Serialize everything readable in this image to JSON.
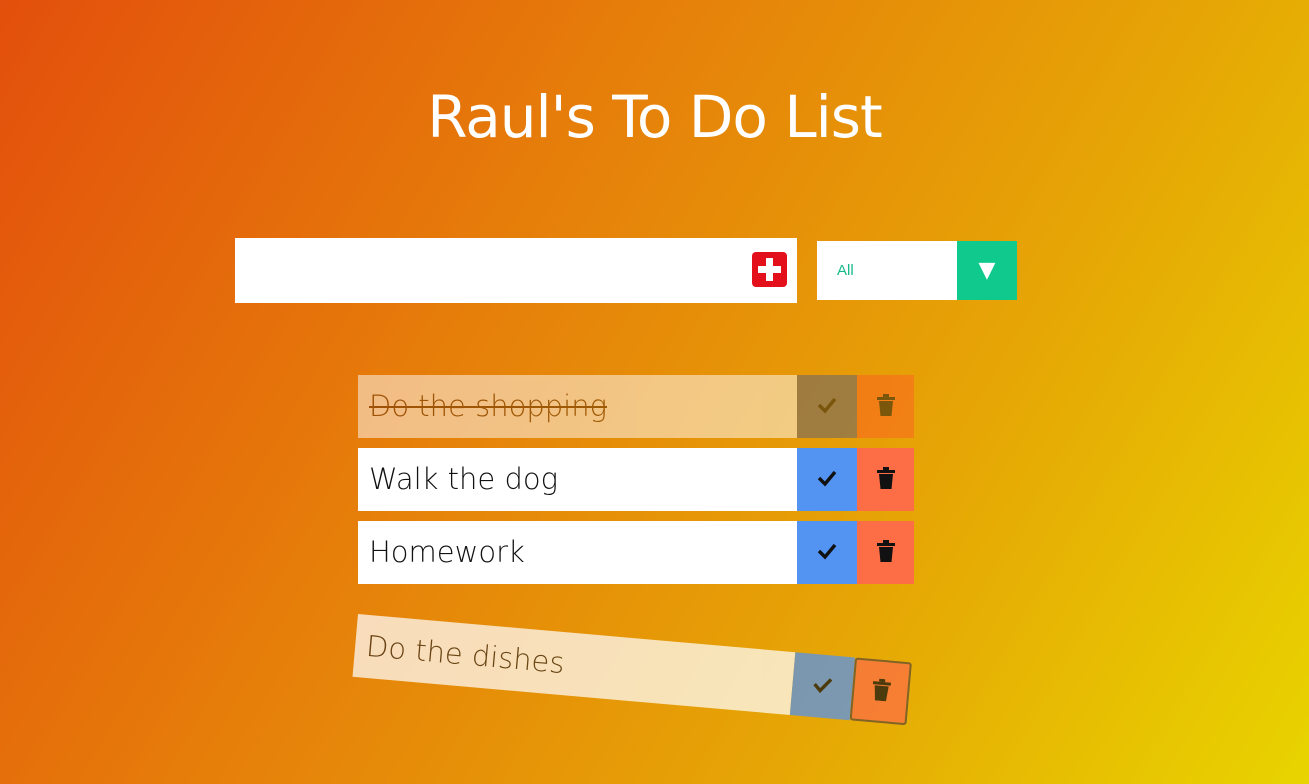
{
  "header": {
    "title": "Raul's To Do List"
  },
  "form": {
    "input_value": "",
    "add_icon": "plus-icon",
    "filter": {
      "selected": "All",
      "arrow_icon": "triangle-down-icon"
    }
  },
  "todos": [
    {
      "text": "Do the shopping",
      "completed": true
    },
    {
      "text": "Walk the dog",
      "completed": false
    },
    {
      "text": "Homework",
      "completed": false
    },
    {
      "text": "Do the dishes",
      "completed": false,
      "state": "dragging"
    }
  ],
  "colors": {
    "check_button": "#5393f2",
    "trash_button": "#fd6e47",
    "add_button": "#e30f1b",
    "filter_accent": "#0fc98d"
  }
}
